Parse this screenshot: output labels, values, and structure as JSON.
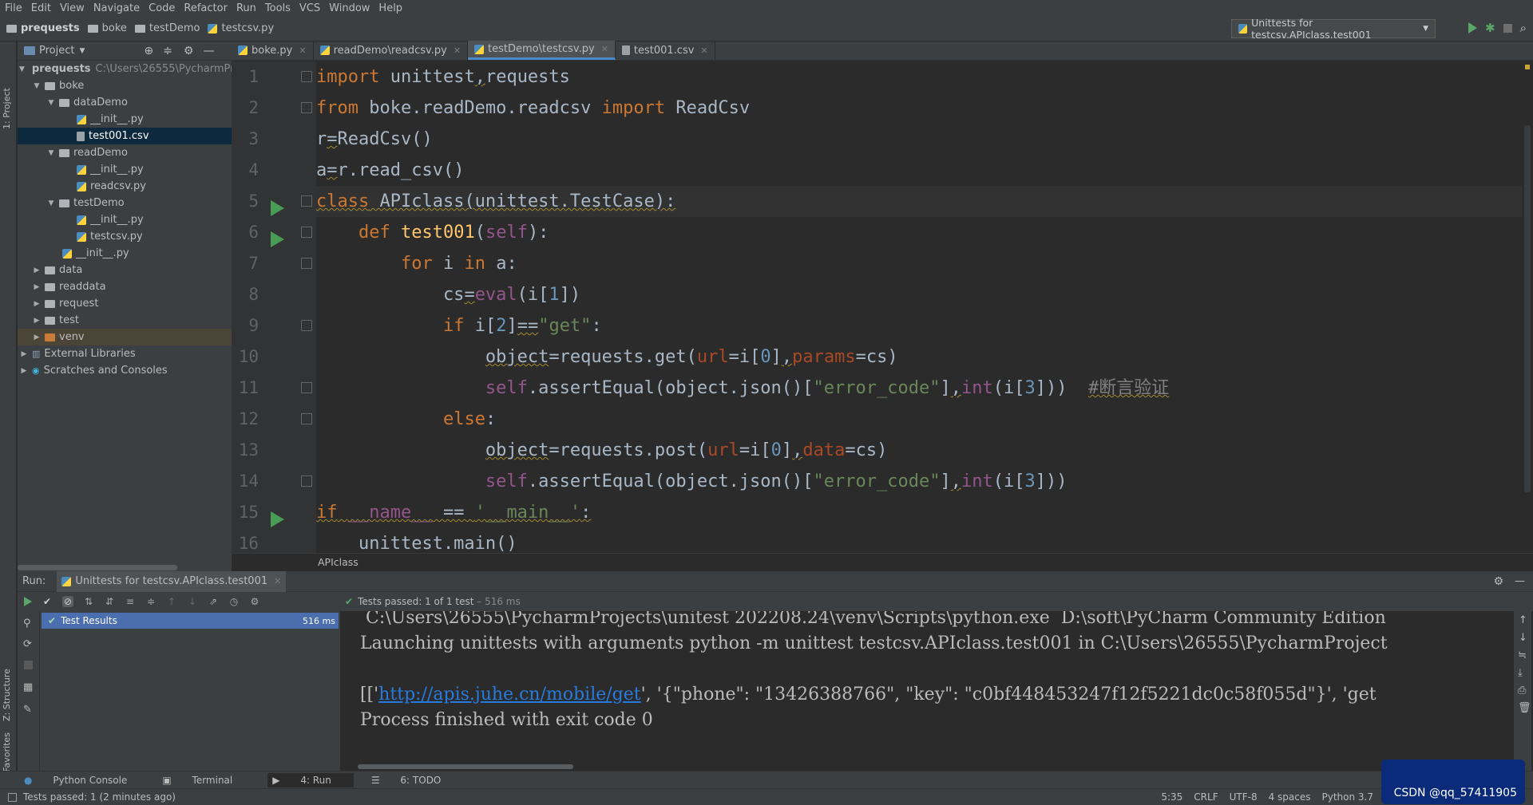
{
  "menu": [
    "File",
    "Edit",
    "View",
    "Navigate",
    "Code",
    "Refactor",
    "Run",
    "Tools",
    "VCS",
    "Window",
    "Help"
  ],
  "breadcrumbs": [
    "prequests",
    "boke",
    "testDemo",
    "testcsv.py"
  ],
  "run_config": "Unittests for testcsv.APIclass.test001",
  "left_tabs": {
    "project": "1: Project",
    "structure": "Z: Structure",
    "favorites": "2: Favorites"
  },
  "project": {
    "header": "Project",
    "root_name": "prequests",
    "root_path": "C:\\Users\\26555\\PycharmPro",
    "items": [
      {
        "label": "boke"
      },
      {
        "label": "dataDemo"
      },
      {
        "label": "__init__.py"
      },
      {
        "label": "test001.csv"
      },
      {
        "label": "readDemo"
      },
      {
        "label": "__init__.py"
      },
      {
        "label": "readcsv.py"
      },
      {
        "label": "testDemo"
      },
      {
        "label": "__init__.py"
      },
      {
        "label": "testcsv.py"
      },
      {
        "label": "__init__.py"
      },
      {
        "label": "data"
      },
      {
        "label": "readdata"
      },
      {
        "label": "request"
      },
      {
        "label": "test"
      },
      {
        "label": "venv"
      },
      {
        "label": "External Libraries"
      },
      {
        "label": "Scratches and Consoles"
      }
    ]
  },
  "tabs": [
    {
      "label": "boke.py"
    },
    {
      "label": "readDemo\\readcsv.py"
    },
    {
      "label": "testDemo\\testcsv.py"
    },
    {
      "label": "test001.csv"
    }
  ],
  "line_numbers": [
    "1",
    "2",
    "3",
    "4",
    "5",
    "6",
    "7",
    "8",
    "9",
    "10",
    "11",
    "12",
    "13",
    "14",
    "15",
    "16"
  ],
  "code_breadcrumb": "APIclass",
  "run": {
    "label": "Run:",
    "tab": "Unittests for testcsv.APIclass.test001",
    "status_passed": "Tests passed:",
    "status_count": "1 of 1 test",
    "status_time": "– 516 ms",
    "tree_root": "Test Results",
    "tree_time": "516 ms",
    "console": {
      "line1": " C:\\Users\\26555\\PycharmProjects\\unitest 202208.24\\venv\\Scripts\\python.exe  D:\\soft\\PyCharm Community Edition",
      "line2": "Launching unittests with arguments python -m unittest testcsv.APIclass.test001 in C:\\Users\\26555\\PycharmProject",
      "line3_pre": "[['",
      "line3_link": "http://apis.juhe.cn/mobile/get",
      "line3_post": "', '{\"phone\": \"13426388766\", \"key\": \"c0bf448453247f12f5221dc0c58f055d\"}', 'get",
      "line4": "Process finished with exit code 0"
    }
  },
  "bottom_tabs": [
    "Python Console",
    "Terminal",
    "4: Run",
    "6: TODO"
  ],
  "status": {
    "message": "Tests passed: 1 (2 minutes ago)",
    "position": "5:35",
    "line_sep": "CRLF",
    "encoding": "UTF-8",
    "indent": "4 spaces",
    "interpreter": "Python 3.7"
  },
  "watermark": "CSDN @qq_57411905"
}
